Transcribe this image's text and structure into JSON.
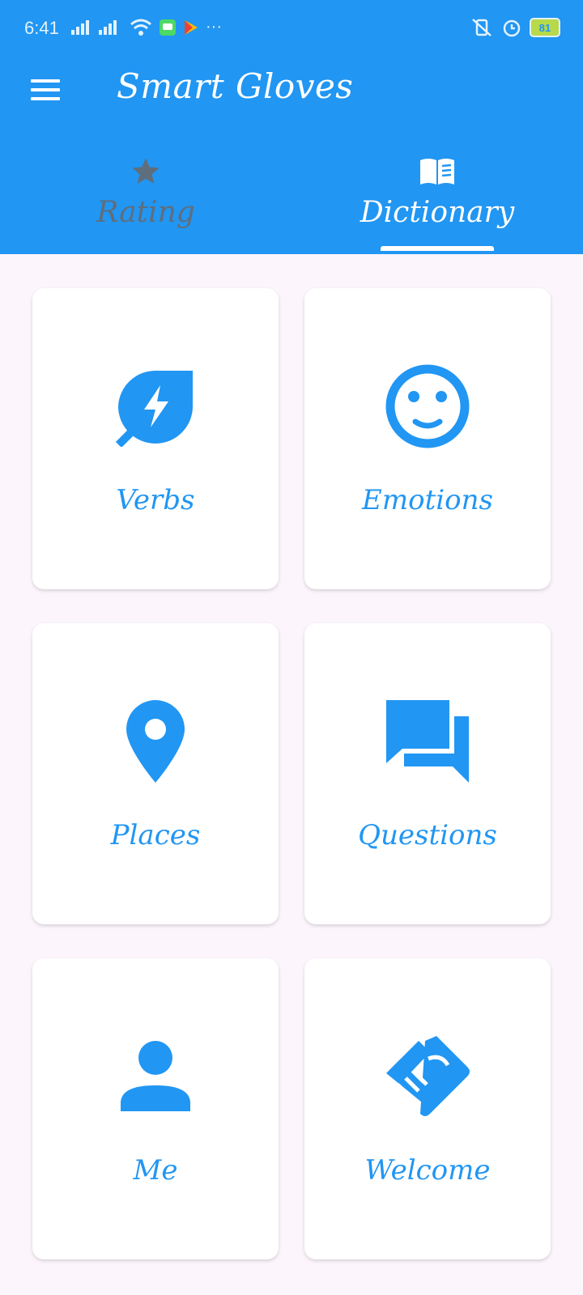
{
  "status_bar": {
    "time": "6:41",
    "battery": "81"
  },
  "app_bar": {
    "title": "Smart Gloves"
  },
  "tabs": [
    {
      "label": "Rating",
      "icon": "star-icon"
    },
    {
      "label": "Dictionary",
      "icon": "book-icon"
    }
  ],
  "categories": [
    {
      "label": "Verbs",
      "icon": "leaf-bolt-icon"
    },
    {
      "label": "Emotions",
      "icon": "smile-icon"
    },
    {
      "label": "Places",
      "icon": "location-pin-icon"
    },
    {
      "label": "Questions",
      "icon": "chat-bubbles-icon"
    },
    {
      "label": "Me",
      "icon": "person-icon"
    },
    {
      "label": "Welcome",
      "icon": "handshake-icon"
    }
  ],
  "colors": {
    "primary": "#2196F3",
    "background": "#FCF5FC",
    "inactive_tab": "#5E6E7D"
  }
}
